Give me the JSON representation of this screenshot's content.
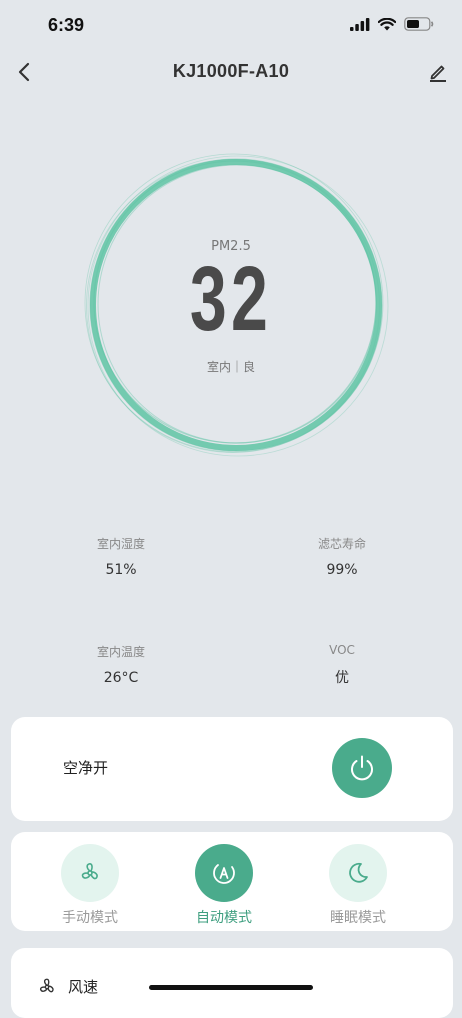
{
  "status_bar": {
    "time": "6:39"
  },
  "nav": {
    "title": "KJ1000F-A10",
    "back_icon": "chevron-left-icon",
    "edit_icon": "pencil-icon"
  },
  "air_quality": {
    "label": "PM2.5",
    "value": "32",
    "subtitle": "室内｜良",
    "ring_color": "#5fc4a4"
  },
  "stats": [
    {
      "label": "室内湿度",
      "value": "51%"
    },
    {
      "label": "滤芯寿命",
      "value": "99%"
    },
    {
      "label": "室内温度",
      "value": "26°C"
    },
    {
      "label": "VOC",
      "value": "优"
    }
  ],
  "power": {
    "label": "空净开",
    "icon": "power-icon",
    "color": "#4aab8c"
  },
  "modes": [
    {
      "label": "手动模式",
      "icon": "fan-icon",
      "active": false
    },
    {
      "label": "自动模式",
      "icon": "auto-icon",
      "active": true
    },
    {
      "label": "睡眠模式",
      "icon": "moon-icon",
      "active": false
    }
  ],
  "speed": {
    "label": "风速",
    "icon": "fan-icon"
  }
}
